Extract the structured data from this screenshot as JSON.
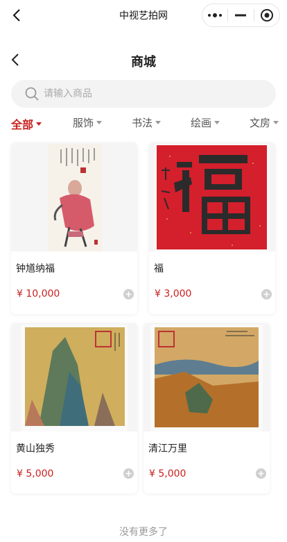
{
  "window": {
    "title": "中视艺拍网"
  },
  "header": {
    "title": "商城"
  },
  "search": {
    "placeholder": "请输入商品"
  },
  "categories": [
    {
      "label": "全部",
      "active": true
    },
    {
      "label": "服饰",
      "active": false
    },
    {
      "label": "书法",
      "active": false
    },
    {
      "label": "绘画",
      "active": false
    },
    {
      "label": "文房",
      "active": false
    }
  ],
  "products": [
    {
      "name": "钟馗纳福",
      "price": "¥ 10,000",
      "image": "figure-painting"
    },
    {
      "name": "福",
      "price": "¥ 3,000",
      "image": "calligraphy-fu"
    },
    {
      "name": "黄山独秀",
      "price": "¥ 5,000",
      "image": "mountain-landscape"
    },
    {
      "name": "清江万里",
      "price": "¥ 5,000",
      "image": "river-landscape"
    }
  ],
  "footer": {
    "text": "没有更多了"
  },
  "colors": {
    "accent": "#c8201f",
    "muted": "#999999",
    "search_bg": "#f3f3f3"
  }
}
